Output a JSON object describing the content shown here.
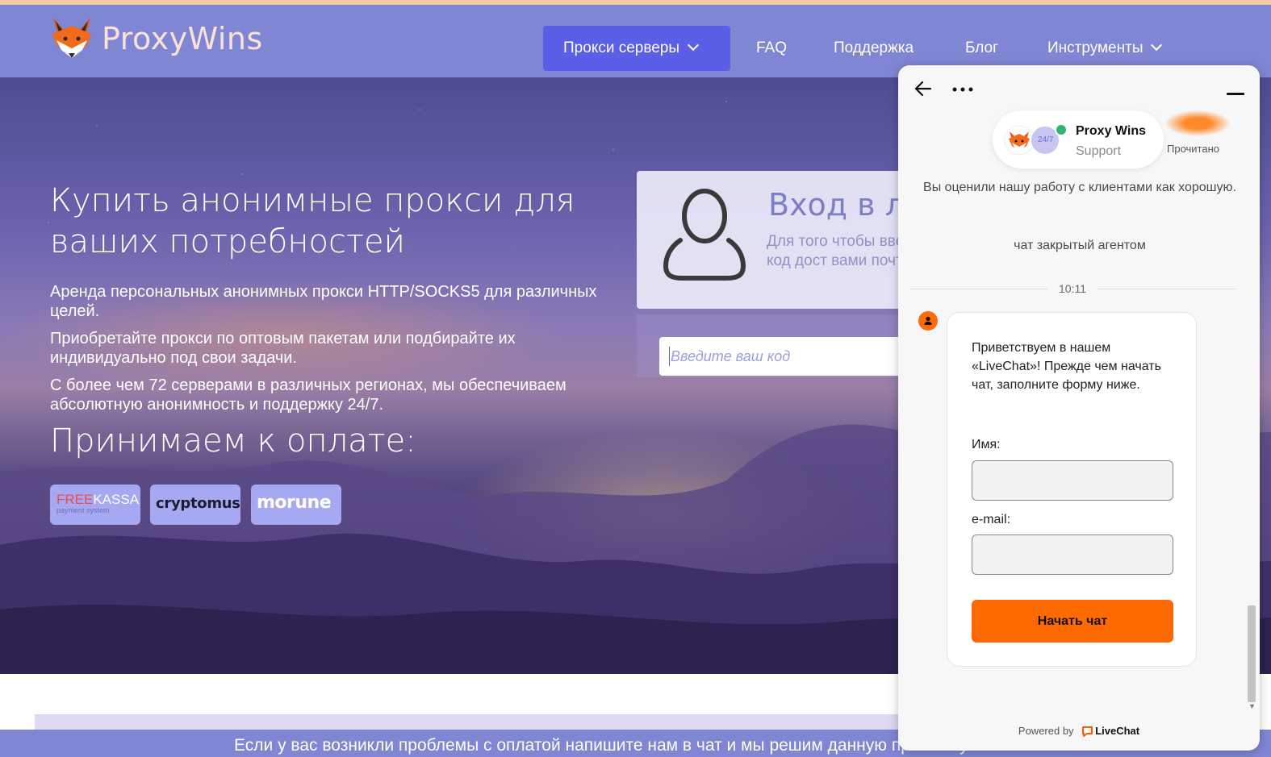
{
  "brand": {
    "logo_text": "ProxyWins"
  },
  "nav": {
    "items": [
      {
        "label": "Прокси серверы",
        "dropdown": true,
        "active": true
      },
      {
        "label": "FAQ"
      },
      {
        "label": "Поддержка"
      },
      {
        "label": "Блог"
      },
      {
        "label": "Инструменты",
        "dropdown": true
      }
    ]
  },
  "hero": {
    "title": "Купить анонимные прокси для ваших потребностей",
    "paragraphs": [
      "Аренда персональных анонимных прокси HTTP/SOCKS5 для различных целей.",
      "Приобретайте прокси по оптовым пакетам или подбирайте их индивидуально под свои задачи.",
      "С более чем 72 серверами в различных регионах, мы обеспечиваем абсолютную анонимность и поддержку 24/7."
    ],
    "payment_title": "Принимаем к оплате:",
    "payments": {
      "freekassa_a": "FREE",
      "freekassa_b": "KASSA",
      "freekassa_sub": "payment system",
      "cryptomus": "cryptomus",
      "morune": "morune"
    }
  },
  "login": {
    "title": "Вход в л",
    "description": "Для того чтобы ввести код дост вами почту",
    "code_placeholder": "Введите ваш код"
  },
  "footer": {
    "notice": "Если у вас возникли проблемы с оплатой напишите нам в чат и мы решим данную проблему"
  },
  "chat": {
    "agent_name": "Proxy Wins",
    "agent_role": "Support",
    "badge_247": "24/7",
    "read_status": "Прочитано",
    "rating_note": "Вы оценили нашу работу с клиентами как хорошую.",
    "closed_note": "чат закрытый агентом",
    "time": "10:11",
    "welcome": "Приветствуем в нашем «LiveChat»! Прежде чем начать чат, заполните форму ниже.",
    "name_label": "Имя:",
    "email_label": "e-mail:",
    "start_button": "Начать чат",
    "powered_by": "Powered by",
    "powered_brand": "LiveChat",
    "colors": {
      "accent": "#ff6a00",
      "online": "#2bb673"
    }
  },
  "colors": {
    "navbar": "#7f86d3",
    "nav_active": "#5b5ee6",
    "login_title": "#7b7fc4"
  }
}
